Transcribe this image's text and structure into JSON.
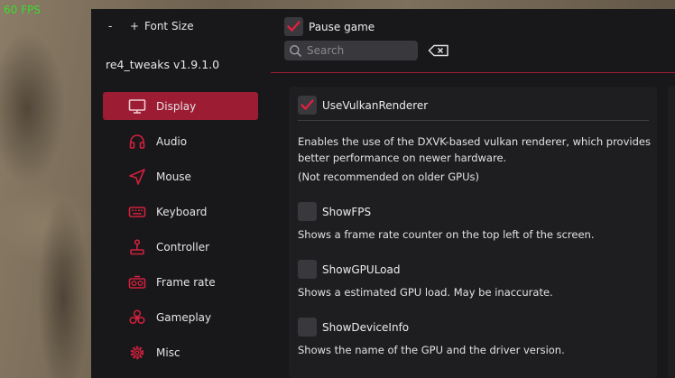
{
  "overlay": {
    "fps": "60 FPS"
  },
  "header": {
    "font_minus": "-",
    "font_plus": "+",
    "font_size_label": "Font Size",
    "version": "re4_tweaks v1.9.1.0"
  },
  "sidebar": {
    "items": [
      {
        "label": "Display",
        "icon": "monitor-icon",
        "active": true
      },
      {
        "label": "Audio",
        "icon": "headphones-icon"
      },
      {
        "label": "Mouse",
        "icon": "cursor-icon"
      },
      {
        "label": "Keyboard",
        "icon": "keyboard-icon"
      },
      {
        "label": "Controller",
        "icon": "joystick-icon"
      },
      {
        "label": "Frame rate",
        "icon": "speedometer-icon"
      },
      {
        "label": "Gameplay",
        "icon": "biohazard-icon"
      },
      {
        "label": "Misc",
        "icon": "gear-icon"
      }
    ]
  },
  "toolbar": {
    "pause_label": "Pause game",
    "pause_checked": true,
    "search_placeholder": "Search",
    "search_value": ""
  },
  "options": {
    "vulkan": {
      "label": "UseVulkanRenderer",
      "checked": true,
      "desc1": "Enables the use of the DXVK-based vulkan renderer, which provides better performance on newer hardware.",
      "desc2": "(Not recommended on older GPUs)"
    },
    "fps": {
      "label": "ShowFPS",
      "checked": false,
      "desc": "Shows a frame rate counter on the top left of the screen."
    },
    "gpuload": {
      "label": "ShowGPULoad",
      "checked": false,
      "desc": "Shows a estimated GPU load. May be inaccurate."
    },
    "deviceinfo": {
      "label": "ShowDeviceInfo",
      "checked": false,
      "desc": "Shows the name of the GPU and the driver version."
    }
  },
  "colors": {
    "accent": "#9c1c34",
    "check": "#e0203f",
    "panel": "#18181a",
    "card": "#1e1e21",
    "fps_text": "#3bdc2d"
  }
}
